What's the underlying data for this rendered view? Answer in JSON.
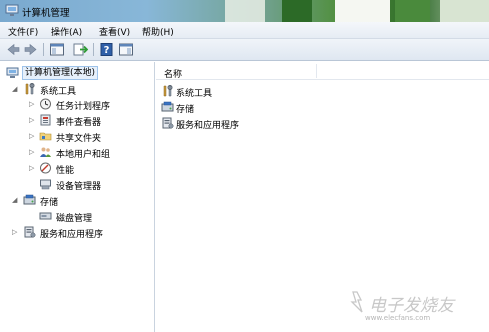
{
  "window": {
    "title": "计算机管理"
  },
  "menu": [
    {
      "label": "文件(F)"
    },
    {
      "label": "操作(A)"
    },
    {
      "label": "查看(V)"
    },
    {
      "label": "帮助(H)"
    }
  ],
  "toolbar": {
    "buttons": [
      "back-icon",
      "forward-icon",
      "show-hide-tree-icon",
      "export-list-icon",
      "help-icon",
      "action-pane-icon"
    ]
  },
  "tree": {
    "root": "计算机管理(本地)",
    "system_tools": "系统工具",
    "task_scheduler": "任务计划程序",
    "event_viewer": "事件查看器",
    "shared_folders": "共享文件夹",
    "local_users": "本地用户和组",
    "performance": "性能",
    "device_manager": "设备管理器",
    "storage": "存储",
    "disk_management": "磁盘管理",
    "services_apps": "服务和应用程序"
  },
  "list": {
    "column_name": "名称",
    "items": [
      "系统工具",
      "存储",
      "服务和应用程序"
    ]
  },
  "watermark": {
    "main": "电子发烧友",
    "sub": "www.elecfans.com"
  }
}
